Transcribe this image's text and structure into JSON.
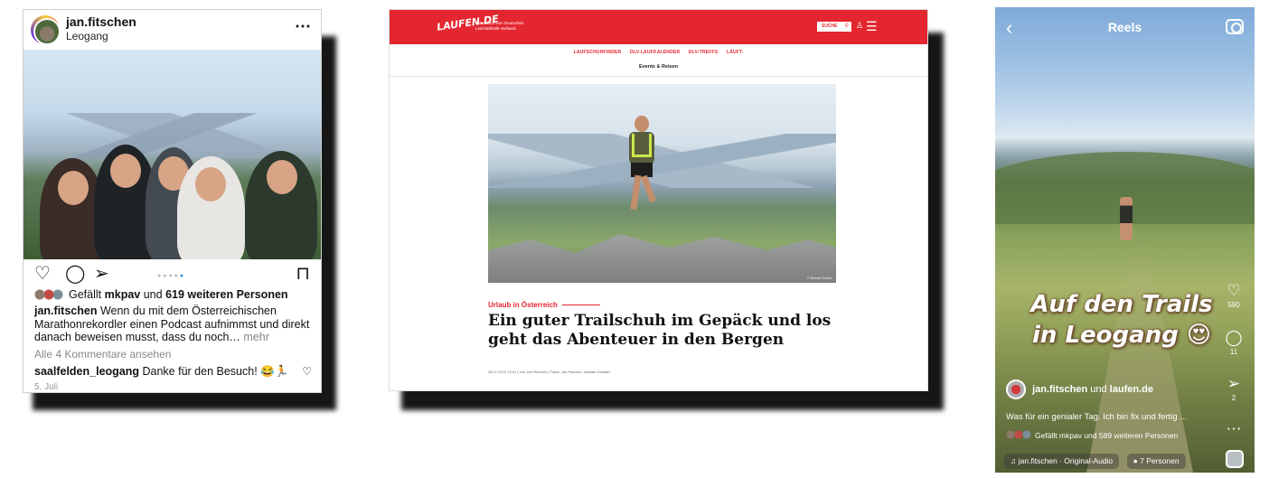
{
  "instagram": {
    "username": "jan.fitschen",
    "location": "Leogang",
    "more_icon": "⋯",
    "likes_prefix": "Gefällt",
    "likes_user": "mkpav",
    "likes_mid": "und",
    "likes_count": "619 weiteren Personen",
    "caption_user": "jan.fitschen",
    "caption_text": "Wenn du mit dem Österreichischen Marathonrekordler einen Podcast aufnimmst und direkt danach beweisen musst, dass du noch…",
    "caption_more": "mehr",
    "view_comments": "Alle 4 Kommentare ansehen",
    "comment_user": "saalfelden_leogang",
    "comment_text": "Danke für den Besuch! 😂🏃",
    "date": "5. Juli",
    "icons": {
      "like": "heart-icon",
      "comment": "comment-icon",
      "share": "send-icon",
      "save": "bookmark-icon"
    }
  },
  "laufen": {
    "logo": "LAUFEN.DE",
    "tagline": "unterstützt vom Deutschen Leichtathletik-Verband",
    "search_label": "SUCHE",
    "nav": [
      "LAUFSCHUHFINDER",
      "DLV-LAUFKALENDER",
      "DLV-TREFFS",
      "LÄUFT."
    ],
    "nav_sub": "Events & Reisen",
    "photo_credit": "© Michael Geißler",
    "kicker": "Urlaub in Österreich",
    "headline": "Ein guter Trailschuh im Gepäck und los geht das Abenteuer in den Bergen",
    "meta": "28.07.2023 13:41 | Von Jan Fitschen | Fotos: Jan Fitschen, Michael Geissler",
    "accent_color": "#e3262f"
  },
  "reels": {
    "title": "Reels",
    "overlay_text": "Auf den Trails in Leogang 😍",
    "like_count": "590",
    "comment_count": "11",
    "share_count": "2",
    "user_line_user": "jan.fitschen",
    "user_line_mid": "und",
    "user_line_collab": "laufen.de",
    "description": "Was für ein genialer Tag. Ich bin fix und fertig ...",
    "likes_text": "Gefällt mkpav und 589 weiteren Personen",
    "audio_chip": "jan.fitschen · Original-Audio",
    "people_chip": "7 Personen"
  }
}
